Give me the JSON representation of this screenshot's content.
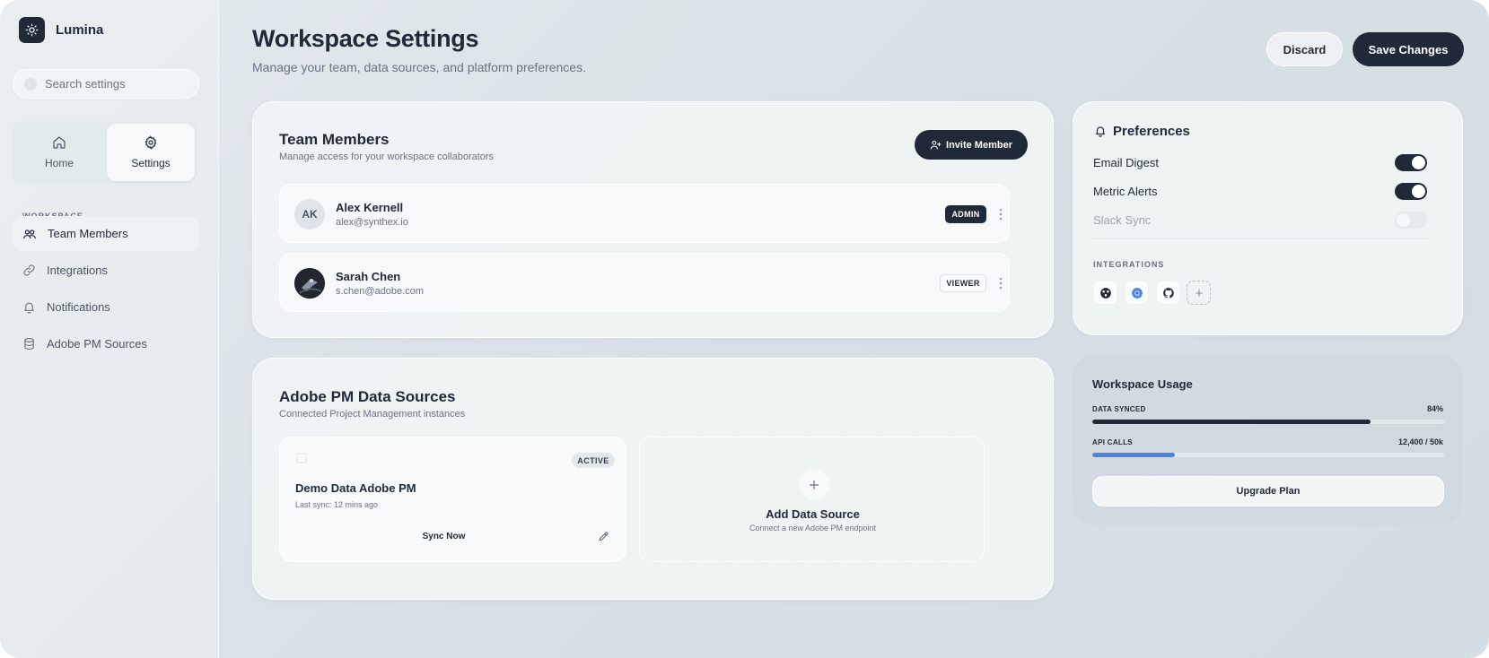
{
  "brand": {
    "name": "Lumina",
    "icon": "sun-icon"
  },
  "search": {
    "placeholder": "Search settings"
  },
  "nav_tiles": [
    {
      "label": "Home",
      "icon": "home-icon",
      "active": false
    },
    {
      "label": "Settings",
      "icon": "gear-icon",
      "active": true
    }
  ],
  "sidebar": {
    "section_label": "WORKSPACE",
    "items": [
      {
        "label": "Team Members",
        "icon": "users-icon",
        "active": true
      },
      {
        "label": "Integrations",
        "icon": "link-icon",
        "active": false
      },
      {
        "label": "Notifications",
        "icon": "bell-icon",
        "active": false
      },
      {
        "label": "Adobe PM Sources",
        "icon": "database-icon",
        "active": false
      }
    ]
  },
  "header": {
    "title": "Workspace Settings",
    "subtitle": "Manage your team, data sources, and platform preferences.",
    "discard_label": "Discard",
    "save_label": "Save Changes"
  },
  "team": {
    "title": "Team Members",
    "subtitle": "Manage access for your workspace collaborators",
    "invite_label": "Invite Member",
    "members": [
      {
        "initials": "AK",
        "name": "Alex Kernell",
        "email": "alex@synthex.io",
        "role": "ADMIN"
      },
      {
        "initials": "",
        "name": "Sarah Chen",
        "email": "s.chen@adobe.com",
        "role": "VIEWER"
      }
    ]
  },
  "datasources": {
    "title": "Adobe PM Data Sources",
    "subtitle": "Connected Project Management instances",
    "source": {
      "status": "ACTIVE",
      "name": "Demo Data Adobe PM",
      "last_sync": "Last sync: 12 mins ago",
      "sync_label": "Sync Now"
    },
    "add": {
      "title": "Add Data Source",
      "subtitle": "Connect a new Adobe PM endpoint"
    }
  },
  "preferences": {
    "title": "Preferences",
    "items": [
      {
        "label": "Email Digest",
        "on": true,
        "disabled": false
      },
      {
        "label": "Metric Alerts",
        "on": true,
        "disabled": false
      },
      {
        "label": "Slack Sync",
        "on": false,
        "disabled": true
      }
    ],
    "integrations_label": "INTEGRATIONS",
    "integrations": [
      "dots-logo-icon",
      "chrome-logo-icon",
      "github-logo-icon",
      "plus-icon"
    ]
  },
  "usage": {
    "title": "Workspace Usage",
    "metrics": [
      {
        "label": "DATA SYNCED",
        "value": "84%",
        "fraction": 0.79,
        "color": "#1f2937"
      },
      {
        "label": "API CALLS",
        "value": "12,400 / 50k",
        "fraction": 0.235,
        "color": "#4a86e0"
      }
    ],
    "upgrade_label": "Upgrade Plan"
  },
  "colors": {
    "primary": "#1f2937",
    "accent_blue": "#4a86e0",
    "muted": "#6b7280"
  }
}
